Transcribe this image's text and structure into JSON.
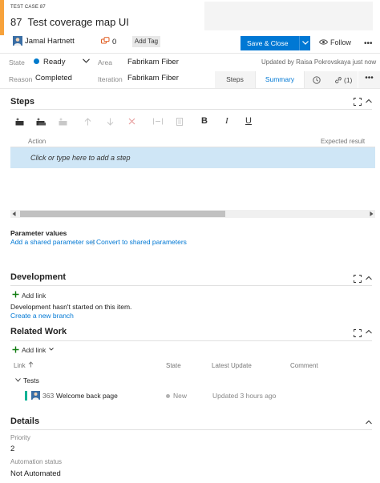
{
  "colors": {
    "accent": "#f7a23b",
    "primary": "#0078d4",
    "state_dot": "#007acc",
    "link": "#0078d4",
    "related_bar": "#00b294"
  },
  "header": {
    "work_item_type": "TEST CASE 87",
    "id": "87",
    "title": "Test coverage map UI",
    "assignee": "Jamal Hartnett",
    "discussion_count": "0",
    "add_tag_label": "Add Tag",
    "save_label": "Save & Close",
    "follow_label": "Follow",
    "more_label": "•••"
  },
  "fields": {
    "state_label": "State",
    "state_value": "Ready",
    "area_label": "Area",
    "area_value": "Fabrikam Fiber",
    "reason_label": "Reason",
    "reason_value": "Completed",
    "iteration_label": "Iteration",
    "iteration_value": "Fabrikam Fiber",
    "updated_text": "Updated by Raisa Pokrovskaya just now"
  },
  "tabs": {
    "steps": "Steps",
    "summary": "Summary",
    "links_count": "(1)",
    "more_label": "•••"
  },
  "steps": {
    "title": "Steps",
    "toolbar": {
      "bold": "B",
      "italic": "I",
      "underline": "U"
    },
    "col_action": "Action",
    "col_expected": "Expected result",
    "add_step_placeholder": "Click or type here to add a step"
  },
  "parameters": {
    "title": "Parameter values",
    "add_link": "Add a shared parameter set",
    "separator": "|",
    "convert_link": "Convert to shared parameters"
  },
  "development": {
    "title": "Development",
    "add_link": "Add link",
    "status": "Development hasn't started on this item.",
    "create_branch": "Create a new branch"
  },
  "related_work": {
    "title": "Related Work",
    "add_link": "Add link",
    "columns": {
      "link": "Link",
      "state": "State",
      "latest_update": "Latest Update",
      "comment": "Comment"
    },
    "group_label": "Tests",
    "items": [
      {
        "id": "363",
        "title": "Welcome back page",
        "state": "New",
        "updated": "Updated 3 hours ago"
      }
    ]
  },
  "details": {
    "title": "Details",
    "priority_label": "Priority",
    "priority_value": "2",
    "automation_label": "Automation status",
    "automation_value": "Not Automated"
  }
}
